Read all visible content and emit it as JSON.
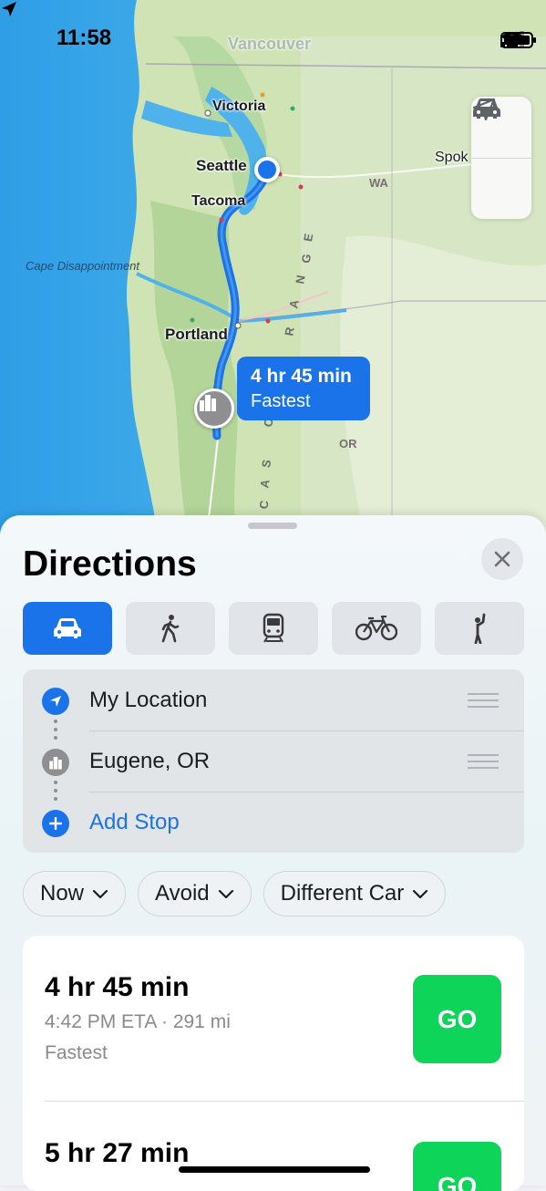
{
  "status_bar": {
    "time": "11:58"
  },
  "map": {
    "labels": {
      "vancouver": "Vancouver",
      "victoria": "Victoria",
      "seattle": "Seattle",
      "tacoma": "Tacoma",
      "portland": "Portland",
      "spokane": "Spok",
      "wa": "WA",
      "or": "OR",
      "cape": "Cape Disappointment",
      "range1": "R",
      "range2": "A",
      "range3": "N",
      "range4": "G",
      "range5": "E",
      "cascade1": "C",
      "cascade2": "S",
      "cascade3": "A",
      "cascade4": "C"
    },
    "callout": {
      "duration": "4 hr 45 min",
      "label": "Fastest"
    },
    "controls": {
      "top_icon": "car-icon",
      "bottom_icon": "location-arrow-icon"
    }
  },
  "sheet": {
    "title": "Directions",
    "modes": [
      {
        "name": "drive",
        "icon": "car-icon",
        "active": true
      },
      {
        "name": "walk",
        "icon": "walking-icon",
        "active": false
      },
      {
        "name": "transit",
        "icon": "train-icon",
        "active": false
      },
      {
        "name": "cycle",
        "icon": "bicycle-icon",
        "active": false
      },
      {
        "name": "ride",
        "icon": "hail-icon",
        "active": false
      }
    ],
    "stops": {
      "origin": "My Location",
      "destination": "Eugene, OR",
      "add": "Add Stop"
    },
    "filters": {
      "time": "Now",
      "avoid": "Avoid",
      "vehicle": "Different Car"
    },
    "routes": [
      {
        "duration": "4 hr 45 min",
        "meta": "4:42 PM ETA · 291 mi",
        "tag": "Fastest",
        "go": "GO"
      },
      {
        "duration": "5 hr 27 min",
        "go": "GO"
      }
    ]
  },
  "colors": {
    "accent": "#1a73e8",
    "go": "#0fd45a",
    "route": "#1a73e8"
  }
}
